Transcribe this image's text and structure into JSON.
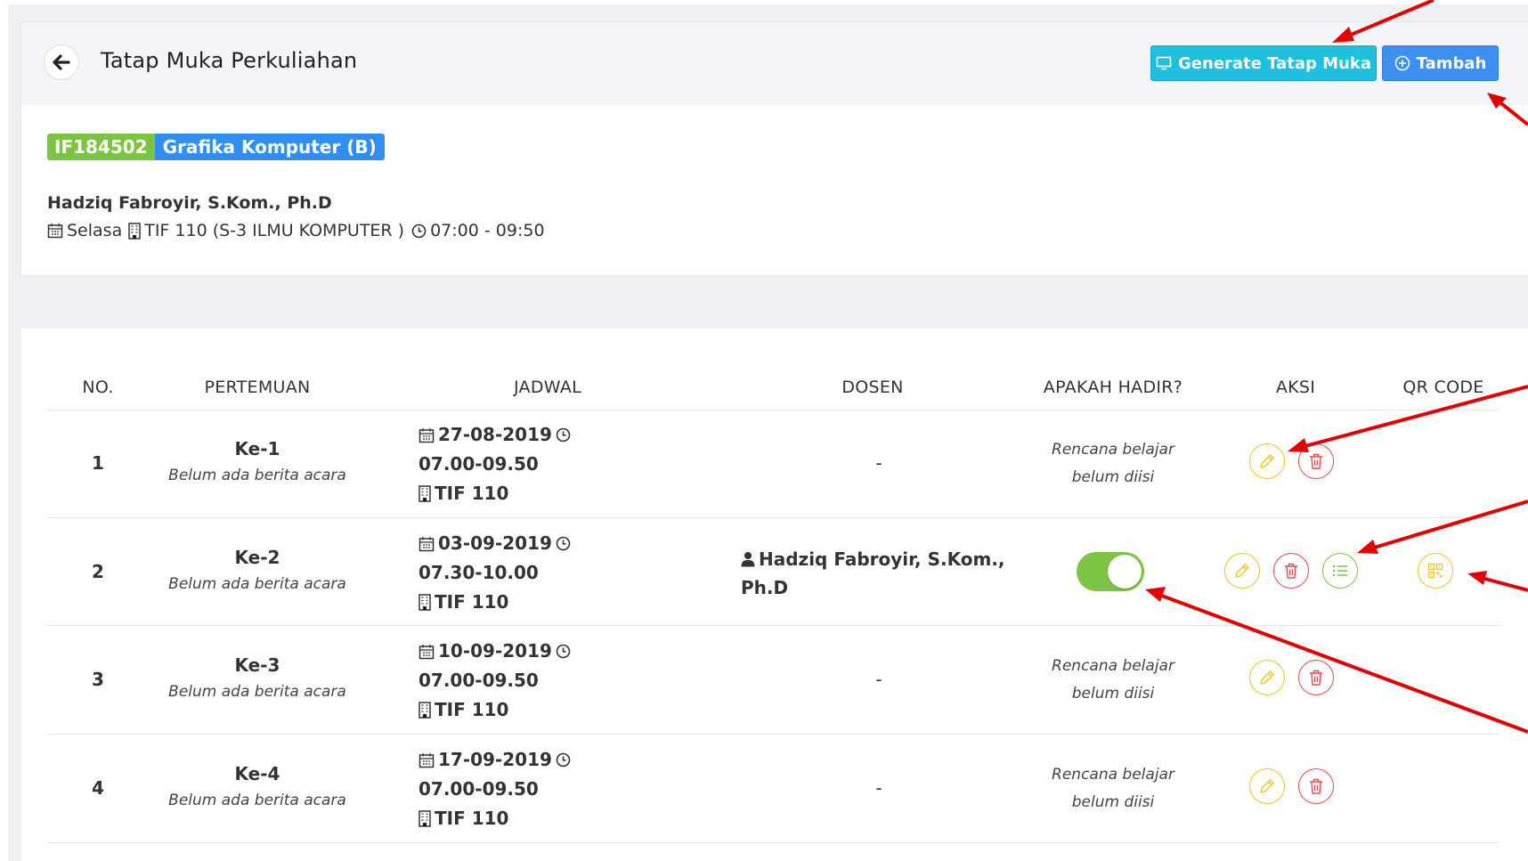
{
  "header": {
    "title": "Tatap Muka Perkuliahan",
    "generate_label": "Generate Tatap Muka",
    "add_label": "Tambah"
  },
  "course": {
    "code": "IF184502",
    "name": "Grafika Komputer (B)",
    "lecturer": "Hadziq Fabroyir, S.Kom., Ph.D",
    "day": "Selasa",
    "room": "TIF 110 (S-3 ILMU KOMPUTER )",
    "time": "07:00 - 09:50"
  },
  "table": {
    "columns": [
      "NO.",
      "PERTEMUAN",
      "JADWAL",
      "DOSEN",
      "APAKAH HADIR?",
      "AKSI",
      "QR CODE"
    ],
    "rows": [
      {
        "no": "1",
        "pertemuan": "Ke-1",
        "note": "Belum ada berita acara",
        "date": "27-08-2019",
        "time": "07.00-09.50",
        "room": "TIF 110",
        "dosen": "-",
        "hadir_line1": "Rencana belajar",
        "hadir_line2": "belum diisi"
      },
      {
        "no": "2",
        "pertemuan": "Ke-2",
        "note": "Belum ada berita acara",
        "date": "03-09-2019",
        "time": "07.30-10.00",
        "room": "TIF 110",
        "dosen_line1": "Hadziq Fabroyir, S.Kom.,",
        "dosen_line2": "Ph.D",
        "hadir_toggle": true
      },
      {
        "no": "3",
        "pertemuan": "Ke-3",
        "note": "Belum ada berita acara",
        "date": "10-09-2019",
        "time": "07.00-09.50",
        "room": "TIF 110",
        "dosen": "-",
        "hadir_line1": "Rencana belajar",
        "hadir_line2": "belum diisi"
      },
      {
        "no": "4",
        "pertemuan": "Ke-4",
        "note": "Belum ada berita acara",
        "date": "17-09-2019",
        "time": "07.00-09.50",
        "room": "TIF 110",
        "dosen": "-",
        "hadir_line1": "Rencana belajar",
        "hadir_line2": "belum diisi"
      }
    ]
  },
  "colors": {
    "cyan": "#1ec0de",
    "blue": "#3d8ff0",
    "green": "#7dc443",
    "yellow": "#f5c518",
    "red": "#f0474f",
    "annotation": "#e30000"
  }
}
